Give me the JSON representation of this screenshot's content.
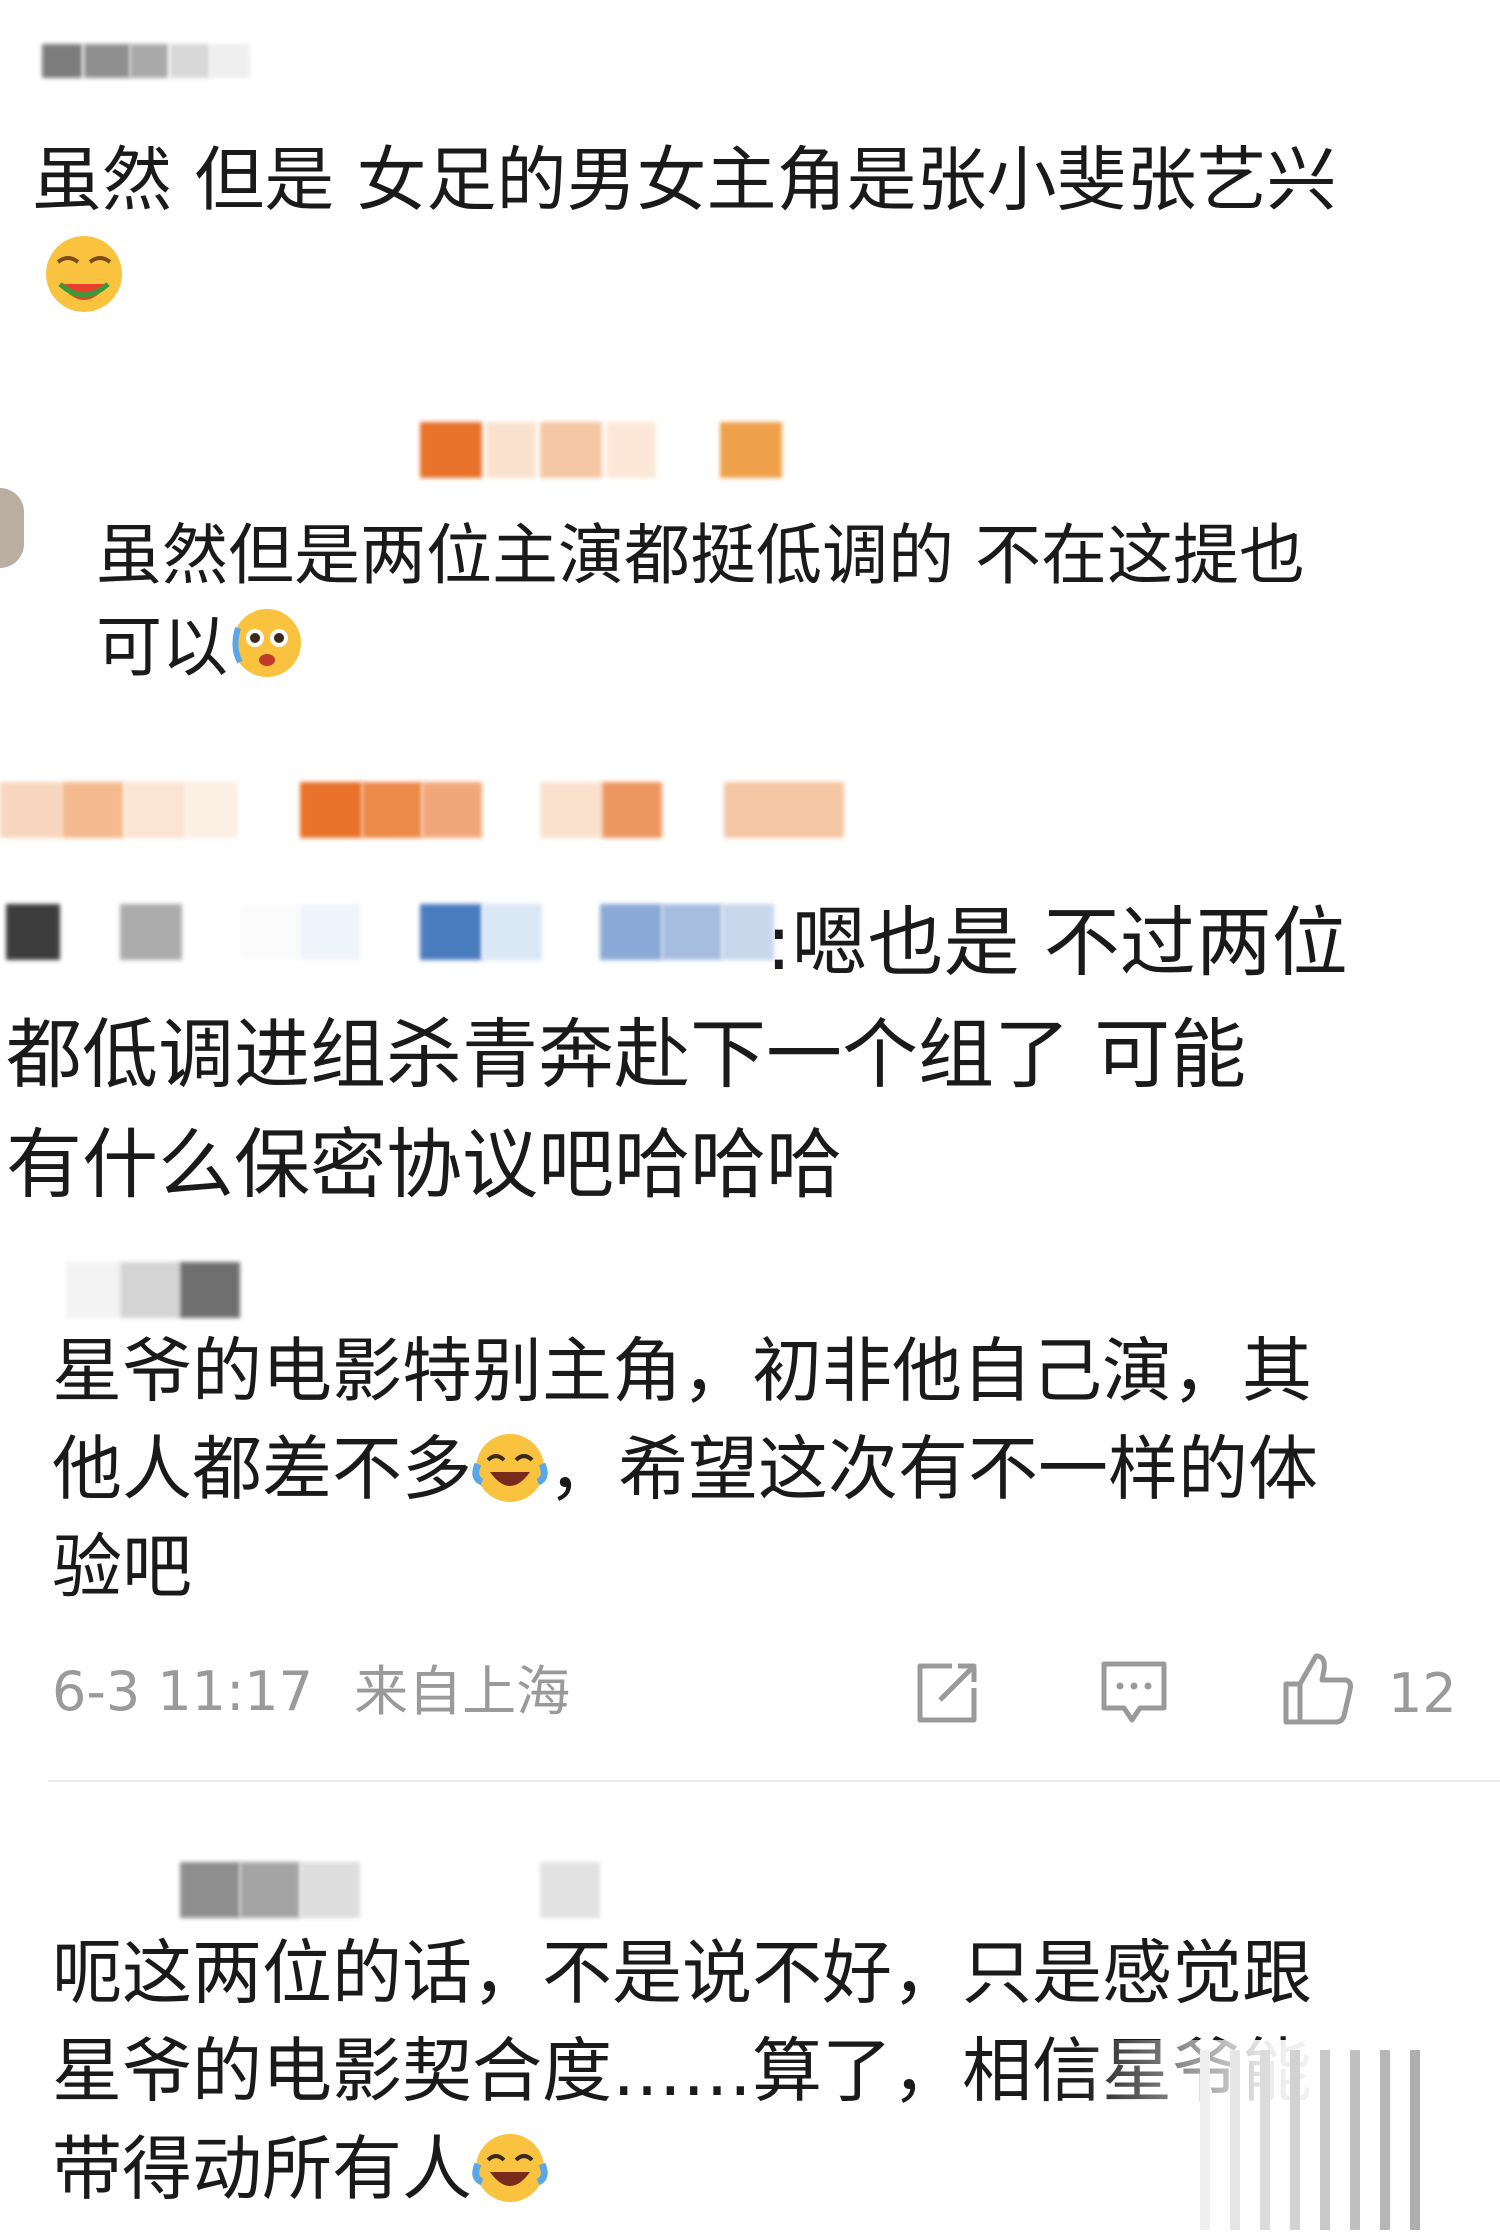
{
  "comments": [
    {
      "text_lines": [
        "虽然 但是 女足的男女主角是张小斐张艺兴"
      ],
      "emoji": "watermelon-grin-emoji"
    },
    {
      "text_lines": [
        "虽然但是两位主演都挺低调的 不在这提也",
        "可以"
      ],
      "emoji": "tearful-smile-emoji"
    },
    {
      "text_lines": [
        ":嗯也是 不过两位",
        "都低调进组杀青奔赴下一个组了 可能",
        "有什么保密协议吧哈哈哈"
      ]
    },
    {
      "text_lines": [
        "星爷的电影特别主角，初非他自己演，其",
        "他人都差不多",
        "，希望这次有不一样的体",
        "验吧"
      ],
      "emoji": "laugh-cry-emoji"
    },
    {
      "text_lines": [
        "呃这两位的话，不是说不好，只是感觉跟",
        "星爷的电影契合度……算了，相信星爷能",
        "带得动所有人"
      ],
      "emoji": "laugh-cry-emoji"
    }
  ],
  "footer": {
    "date": "6-3 11:17",
    "location": "来自上海",
    "like_count": "12",
    "icons": [
      "share-icon",
      "comment-icon",
      "like-icon"
    ]
  },
  "colors": {
    "text": "#1a1a1a",
    "meta": "#9a9a9a",
    "orange": "#e8722a",
    "blue": "#4a7cc0"
  }
}
